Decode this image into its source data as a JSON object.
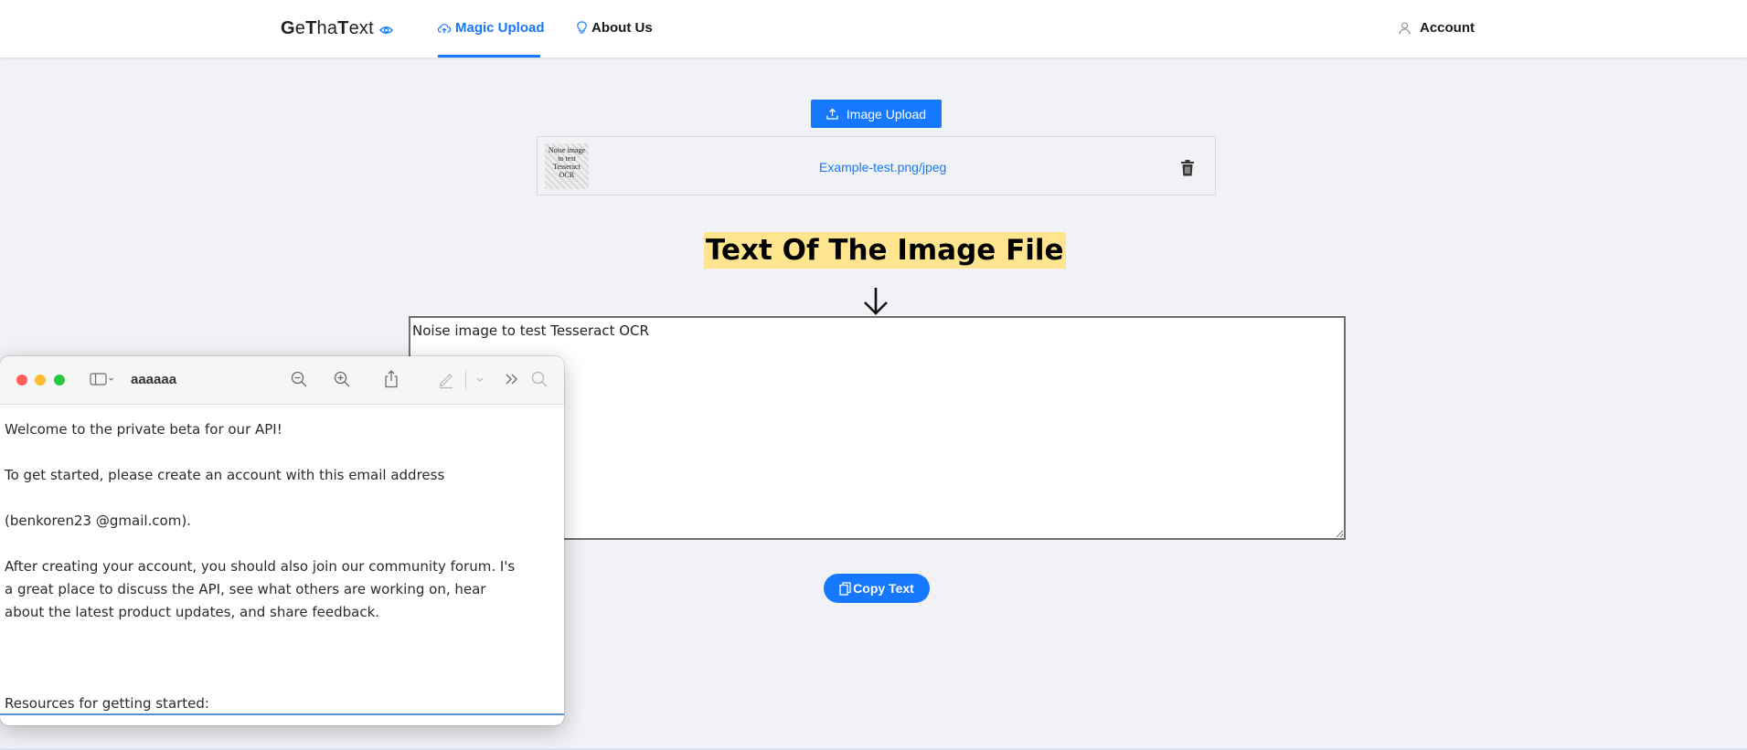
{
  "header": {
    "logo_parts": [
      {
        "text": "G",
        "bold": true
      },
      {
        "text": "e",
        "bold": false
      },
      {
        "text": "T",
        "bold": true
      },
      {
        "text": "ha",
        "bold": false
      },
      {
        "text": "T",
        "bold": true
      },
      {
        "text": "ext",
        "bold": false
      }
    ],
    "nav": {
      "magic_upload": "Magic Upload",
      "about_us": "About Us",
      "account": "Account"
    }
  },
  "upload": {
    "button_label": "Image Upload",
    "file_name": "Example-test.png/jpeg",
    "thumb_text": "Noise image to test Tesseract OCR"
  },
  "result": {
    "heading": "Text Of The Image File",
    "ocr_text": "Noise image to test Tesseract OCR",
    "copy_label": "Copy Text"
  },
  "preview_window": {
    "title": "aaaaaa",
    "paragraphs": [
      "Welcome to the private beta for our API!",
      "",
      "To get started, please create an account with this email address",
      "",
      "(benkoren23 @gmail.com).",
      "",
      "After creating your account, you should also join our community forum. I's a great place to discuss the API, see what others are working on, hear about the latest product updates, and share feedback.",
      "",
      "",
      "",
      "Resources for getting started:"
    ]
  },
  "colors": {
    "accent": "#1677ff",
    "background": "#f0f2f5",
    "heading_highlight": "#ffe58f"
  },
  "icons": [
    "eye-icon",
    "cloud-upload-icon",
    "bulb-icon",
    "user-icon",
    "upload-icon",
    "trash-icon",
    "arrow-down-icon",
    "copy-icon",
    "sidebar-icon",
    "zoom-out-icon",
    "zoom-in-icon",
    "share-icon",
    "markup-pen-icon",
    "chevron-down-icon",
    "more-icon",
    "search-icon"
  ]
}
